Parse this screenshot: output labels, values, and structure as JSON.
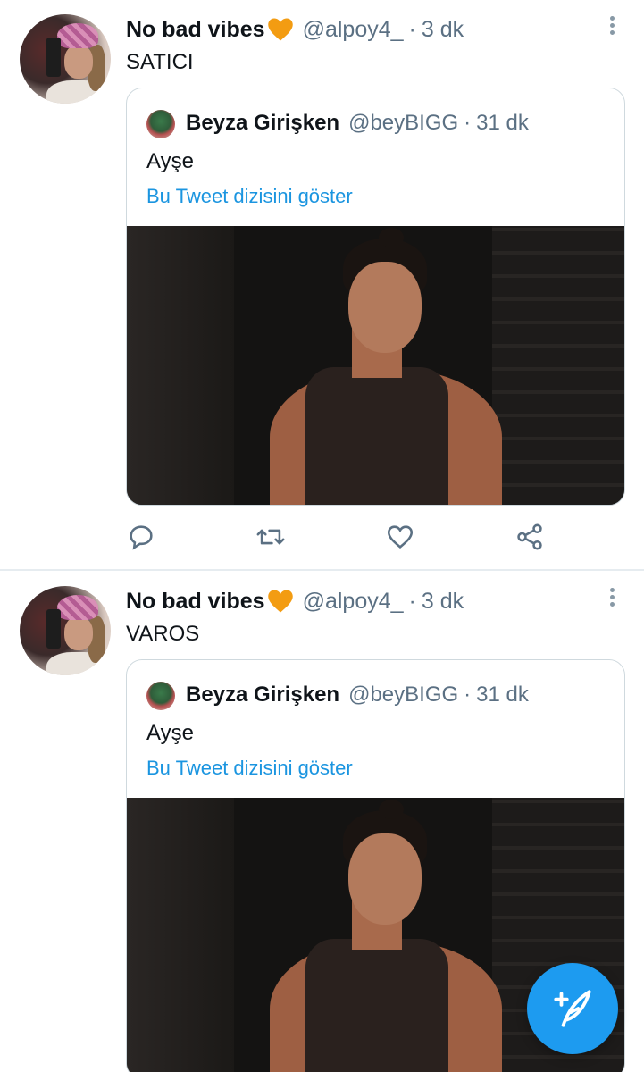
{
  "colors": {
    "accent": "#1b95e0",
    "fab": "#1d9bf0",
    "secondary_text": "#5b7083",
    "heart_emoji": "#f39c12"
  },
  "tweets": [
    {
      "author_name": "No bad vibes",
      "author_emoji": "orange-heart",
      "handle": "@alpoy4_",
      "separator": "·",
      "time": "3 dk",
      "text": "SATICI",
      "quote": {
        "author_name": "Beyza Girişken",
        "handle": "@beyBIGG",
        "separator": "·",
        "time": "31 dk",
        "text": "Ayşe",
        "thread_link": "Bu Tweet dizisini göster"
      },
      "actions": [
        "reply-icon",
        "retweet-icon",
        "like-icon",
        "share-icon"
      ]
    },
    {
      "author_name": "No bad vibes",
      "author_emoji": "orange-heart",
      "handle": "@alpoy4_",
      "separator": "·",
      "time": "3 dk",
      "text": "VAROS",
      "quote": {
        "author_name": "Beyza Girişken",
        "handle": "@beyBIGG",
        "separator": "·",
        "time": "31 dk",
        "text": "Ayşe",
        "thread_link": "Bu Tweet dizisini göster"
      }
    }
  ],
  "fab": {
    "icon": "compose-tweet-icon"
  }
}
